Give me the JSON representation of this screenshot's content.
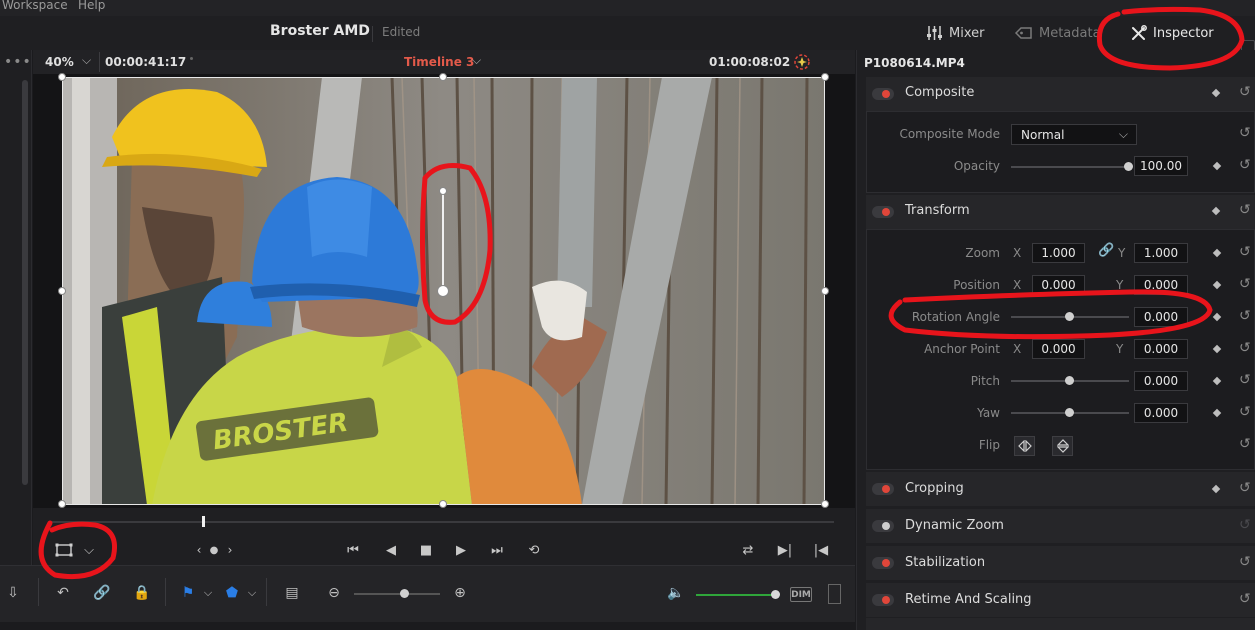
{
  "menu": {
    "workspace": "Workspace",
    "help": "Help"
  },
  "title": {
    "project": "Broster AMD",
    "status": "Edited"
  },
  "panels": {
    "mixer": "Mixer",
    "metadata": "Metadata",
    "inspector": "Inspector"
  },
  "viewer": {
    "zoom": "40%",
    "timecode_left": "00:00:41:17",
    "timeline": "Timeline 3",
    "timecode_right": "01:00:08:02",
    "video_text": "BROSTER"
  },
  "inspector": {
    "clip": "P1080614.MP4",
    "sections": {
      "composite": "Composite",
      "transform": "Transform",
      "cropping": "Cropping",
      "dynamic_zoom": "Dynamic Zoom",
      "stabilization": "Stabilization",
      "retime": "Retime And Scaling"
    },
    "composite": {
      "mode_label": "Composite Mode",
      "mode_value": "Normal",
      "opacity_label": "Opacity",
      "opacity_value": "100.00",
      "opacity_fraction": 1.0
    },
    "transform": {
      "x": "X",
      "y": "Y",
      "zoom_label": "Zoom",
      "zoom_x": "1.000",
      "zoom_y": "1.000",
      "position_label": "Position",
      "position_x": "0.000",
      "position_y": "0.000",
      "rotation_label": "Rotation Angle",
      "rotation_value": "0.000",
      "anchor_label": "Anchor Point",
      "anchor_x": "0.000",
      "anchor_y": "0.000",
      "pitch_label": "Pitch",
      "pitch_value": "0.000",
      "yaw_label": "Yaw",
      "yaw_value": "0.000",
      "flip_label": "Flip"
    }
  },
  "toolbar": {
    "dim": "DIM"
  },
  "colors": {
    "accent_red": "#e0463a",
    "timeline_red": "#e35a4a",
    "annotation_red": "#e8141b",
    "volume_green": "#2fa53a",
    "marker_blue": "#2a7ee6"
  }
}
